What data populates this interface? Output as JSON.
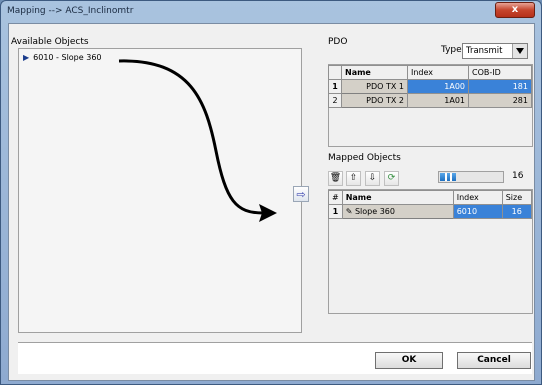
{
  "window": {
    "title": "Mapping --> ACS_Inclinomtr",
    "close_label": "x"
  },
  "available": {
    "label": "Available Objects",
    "items": [
      {
        "label": "6010 - Slope 360"
      }
    ]
  },
  "pdo": {
    "label": "PDO",
    "type_label": "Type",
    "type_value": "Transmit",
    "columns": [
      "Name",
      "Index",
      "COB-ID"
    ],
    "rows": [
      {
        "num": "1",
        "name": "PDO TX 1",
        "index": "1A00",
        "cob_id": "181"
      },
      {
        "num": "2",
        "name": "PDO TX 2",
        "index": "1A01",
        "cob_id": "281"
      }
    ]
  },
  "mapped": {
    "label": "Mapped Objects",
    "size_value": "16",
    "fill_fraction": 0.25,
    "columns": [
      "#",
      "Name",
      "Index",
      "Size"
    ],
    "rows": [
      {
        "num": "1",
        "name": "Slope 360",
        "index": "6010",
        "size": "16"
      }
    ]
  },
  "buttons": {
    "ok": "OK",
    "cancel": "Cancel"
  }
}
